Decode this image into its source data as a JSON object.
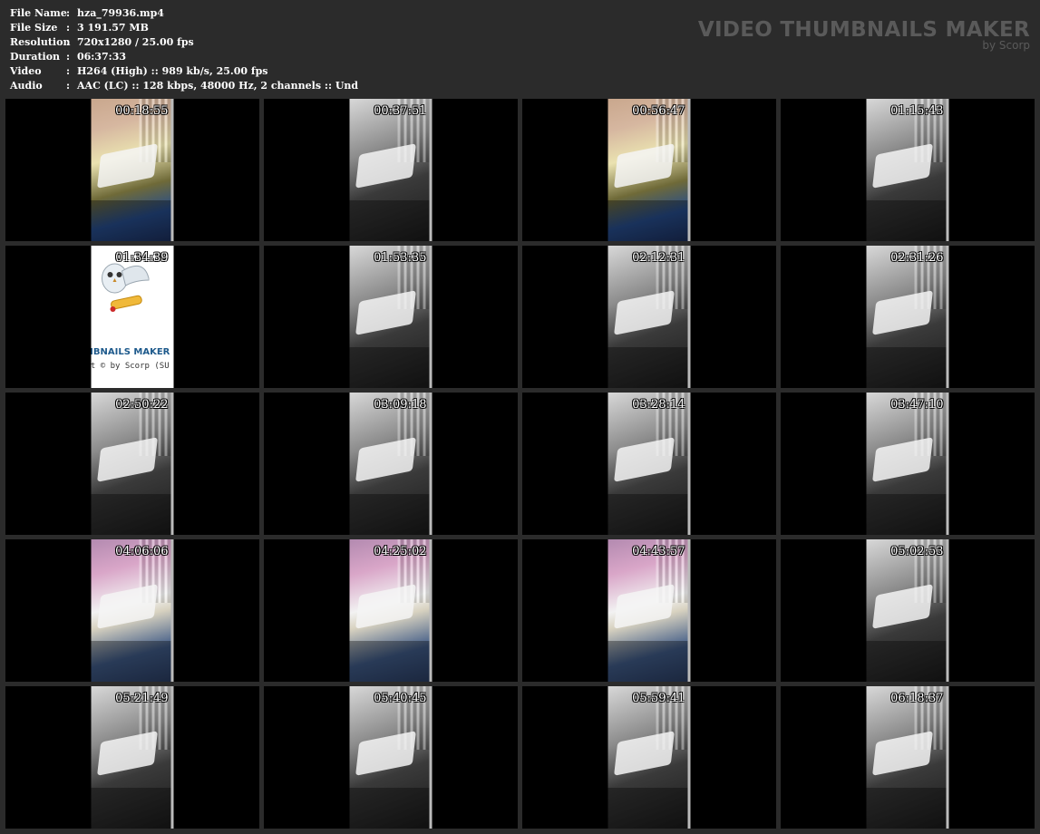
{
  "info": [
    {
      "label": "File Name",
      "value": "hza_79936.mp4"
    },
    {
      "label": "File Size",
      "value": "3 191.57 MB"
    },
    {
      "label": "Resolution",
      "value": "720x1280 / 25.00 fps"
    },
    {
      "label": "Duration",
      "value": "06:37:33"
    },
    {
      "label": "Video",
      "value": "H264 (High) :: 989 kb/s, 25.00 fps"
    },
    {
      "label": "Audio",
      "value": "AAC (LC) :: 128 kbps, 48000 Hz, 2 channels :: Und"
    }
  ],
  "separator": ":",
  "brand": {
    "title": "VIDEO THUMBNAILS MAKER",
    "subtitle": "by Scorp"
  },
  "logo_frame": {
    "title": "HBNAILS MAKER 8",
    "copyright": "nt © by Scorp (SU"
  },
  "thumbnails": [
    {
      "time": "00:18:55",
      "style": "color"
    },
    {
      "time": "00:37:51",
      "style": "gray"
    },
    {
      "time": "00:56:47",
      "style": "color"
    },
    {
      "time": "01:15:43",
      "style": "gray"
    },
    {
      "time": "01:34:39",
      "style": "logo"
    },
    {
      "time": "01:53:35",
      "style": "gray"
    },
    {
      "time": "02:12:31",
      "style": "gray"
    },
    {
      "time": "02:31:26",
      "style": "gray"
    },
    {
      "time": "02:50:22",
      "style": "gray"
    },
    {
      "time": "03:09:18",
      "style": "gray"
    },
    {
      "time": "03:28:14",
      "style": "gray"
    },
    {
      "time": "03:47:10",
      "style": "gray"
    },
    {
      "time": "04:06:06",
      "style": "pink"
    },
    {
      "time": "04:25:02",
      "style": "pink"
    },
    {
      "time": "04:43:57",
      "style": "pink"
    },
    {
      "time": "05:02:53",
      "style": "gray"
    },
    {
      "time": "05:21:49",
      "style": "gray"
    },
    {
      "time": "05:40:45",
      "style": "gray"
    },
    {
      "time": "05:59:41",
      "style": "gray"
    },
    {
      "time": "06:18:37",
      "style": "gray"
    }
  ]
}
